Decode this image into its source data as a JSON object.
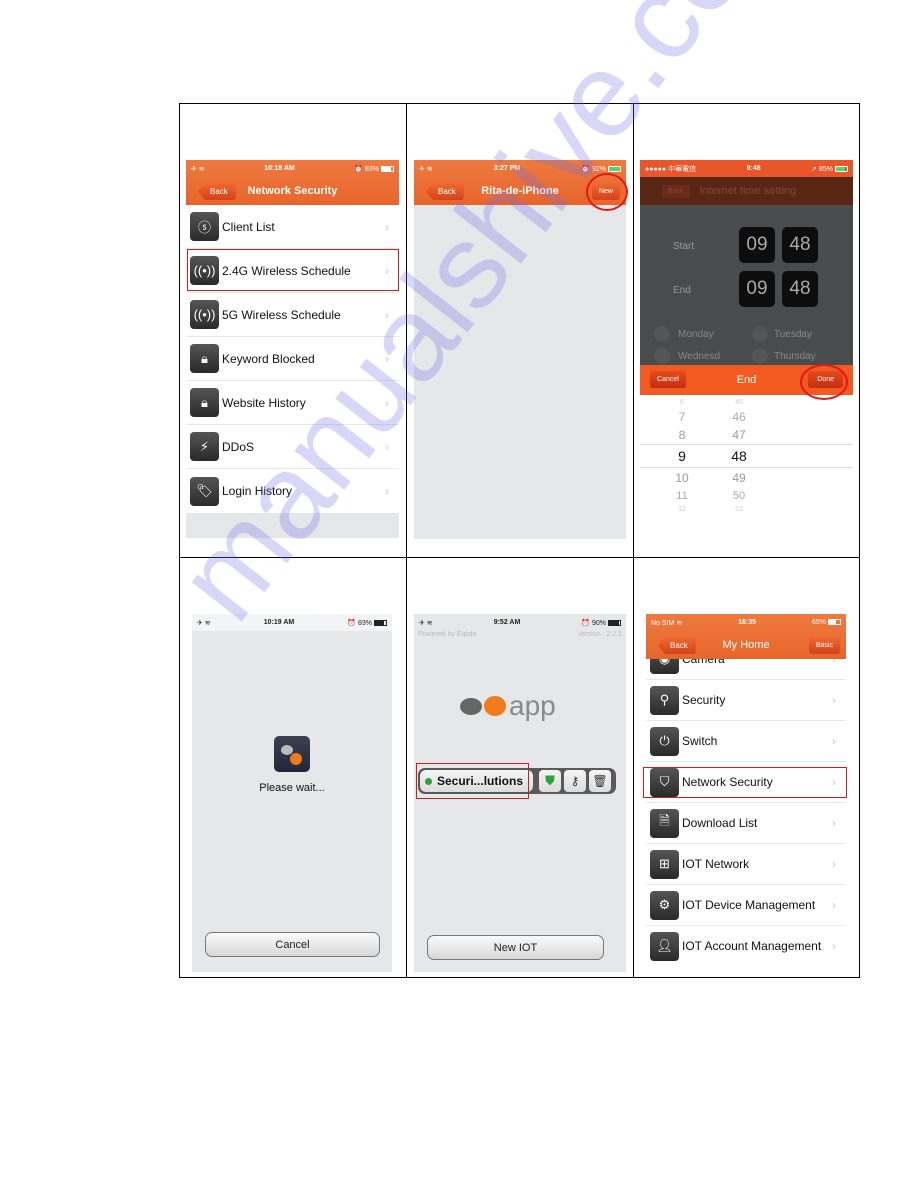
{
  "panels": {
    "p1": {
      "status": {
        "time": "10:18 AM",
        "battery": "83%"
      },
      "nav": {
        "back": "Back",
        "title": "Network Security"
      },
      "items": [
        {
          "label": "Client List",
          "icon": "client-list-icon"
        },
        {
          "label": "2.4G Wireless Schedule",
          "icon": "wireless-schedule-icon",
          "highlighted": true
        },
        {
          "label": "5G Wireless Schedule",
          "icon": "wireless-schedule-icon"
        },
        {
          "label": "Keyword Blocked",
          "icon": "lock-icon"
        },
        {
          "label": "Website History",
          "icon": "lock-icon"
        },
        {
          "label": "DDoS",
          "icon": "lightning-icon"
        },
        {
          "label": "Login History",
          "icon": "tag-icon"
        }
      ]
    },
    "p2": {
      "status": {
        "time": "3:27 PM",
        "battery": "92%"
      },
      "nav": {
        "back": "Back",
        "title": "Rita-de-iPhone",
        "right": "New"
      }
    },
    "p3": {
      "status": {
        "carrier": "●●●●● 中華電信",
        "time": "9:48",
        "battery": "85%"
      },
      "nav": {
        "back": "Back",
        "title": "Internet time setting"
      },
      "start_label": "Start",
      "end_label": "End",
      "start": {
        "hour": "09",
        "minute": "48"
      },
      "end": {
        "hour": "09",
        "minute": "48"
      },
      "days": [
        "Monday",
        "Tuesday",
        "Wednesd",
        "Thursday"
      ],
      "toolbar": {
        "cancel": "Cancel",
        "title": "End",
        "done": "Done"
      },
      "picker": {
        "hours": [
          "6",
          "7",
          "8",
          "9",
          "10",
          "11",
          "12"
        ],
        "minutes": [
          "45",
          "46",
          "47",
          "48",
          "49",
          "50",
          "51"
        ],
        "selected_hour": "9",
        "selected_minute": "48"
      }
    },
    "p4": {
      "status": {
        "time": "10:19 AM",
        "battery": "83%"
      },
      "message": "Please wait...",
      "cancel": "Cancel"
    },
    "p5": {
      "status": {
        "time": "9:52 AM",
        "battery": "90%"
      },
      "powered_by": "Powered by Eqiido",
      "version": "Version : 2.2.1",
      "logo_text": "app",
      "device_name": "Securi...lutions",
      "new_iot": "New IOT"
    },
    "p6": {
      "status": {
        "carrier": "No SIM",
        "time": "16:35",
        "battery": "65%"
      },
      "nav": {
        "back": "Back",
        "title": "My Home",
        "right": "Basic"
      },
      "items": [
        {
          "label": "Camera",
          "icon": "eye-icon"
        },
        {
          "label": "Security",
          "icon": "security-icon"
        },
        {
          "label": "Switch",
          "icon": "plug-icon"
        },
        {
          "label": "Network Security",
          "icon": "shield-icon",
          "highlighted": true
        },
        {
          "label": "Download List",
          "icon": "document-icon"
        },
        {
          "label": "IOT Network",
          "icon": "network-icon"
        },
        {
          "label": "IOT Device Management",
          "icon": "gear-monitor-icon"
        },
        {
          "label": "IOT Account Management",
          "icon": "user-icon"
        }
      ]
    }
  },
  "watermark": "manualshive.com",
  "colors": {
    "accent": "#e8652a",
    "highlight": "#d01c1c"
  }
}
